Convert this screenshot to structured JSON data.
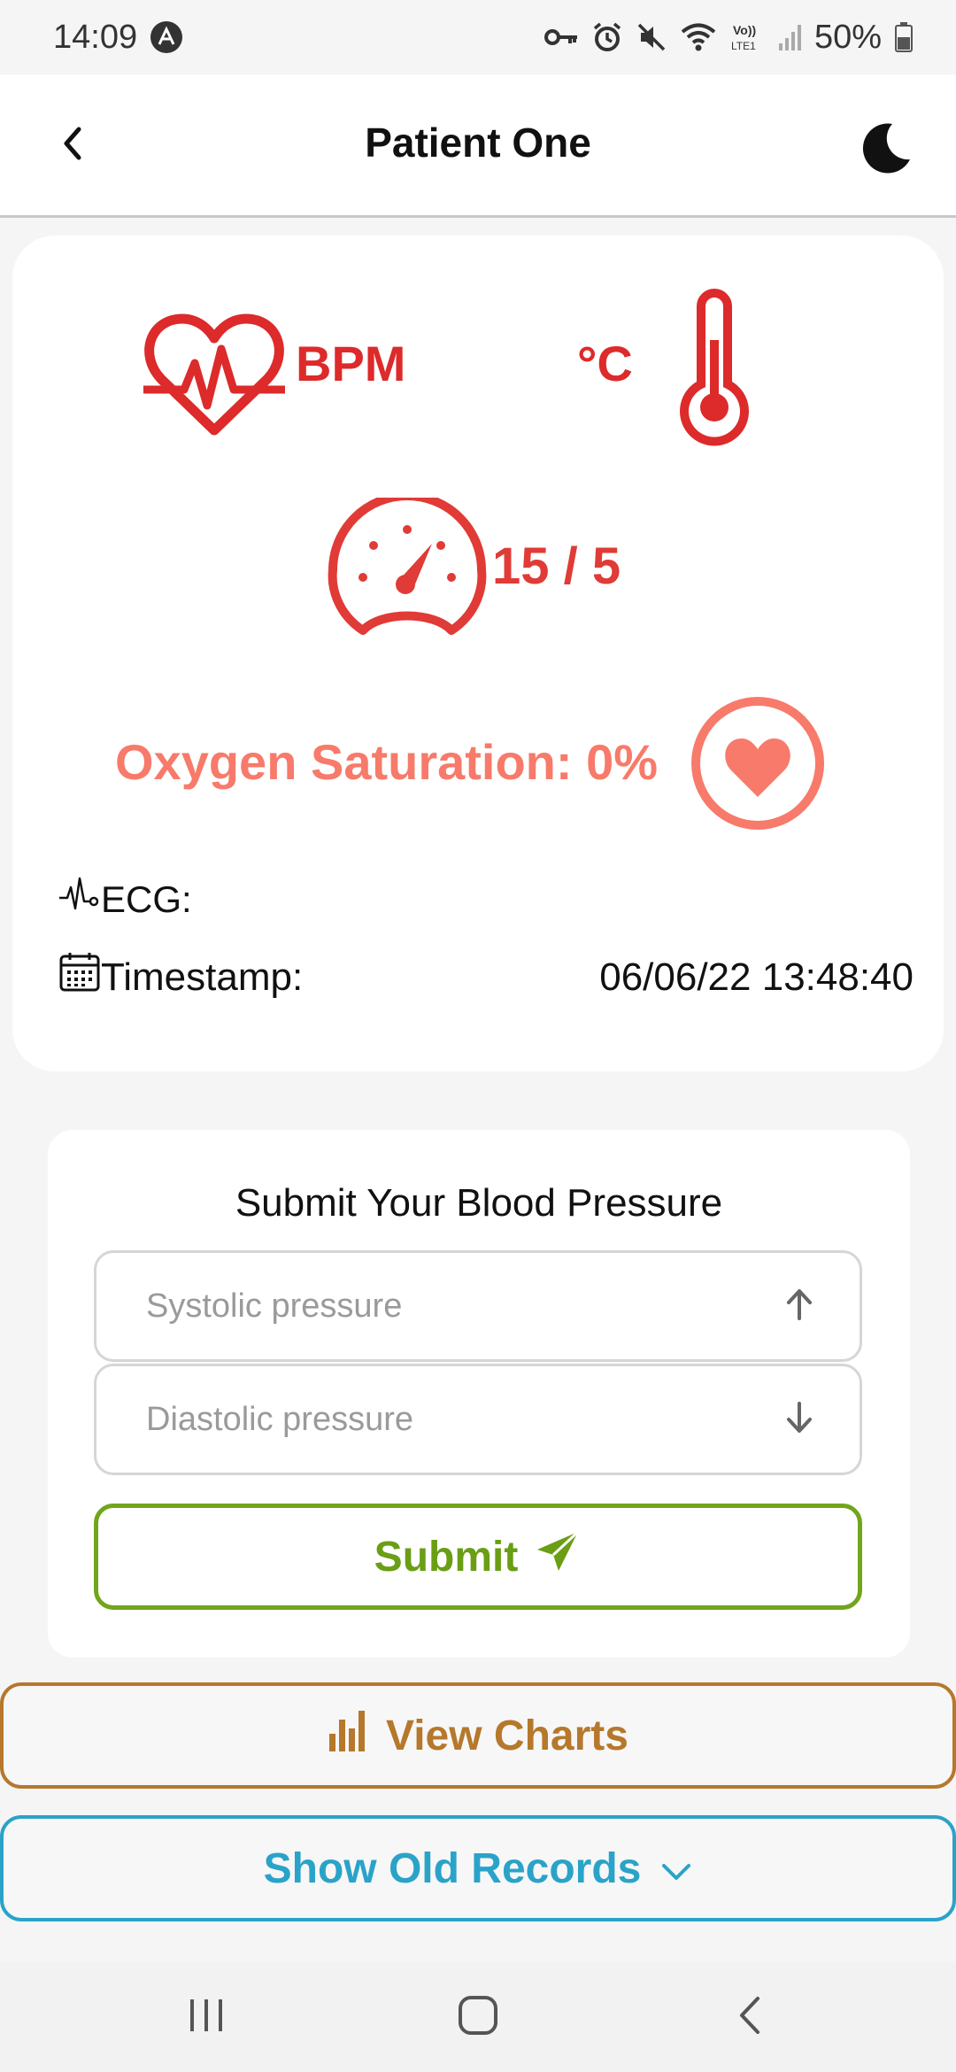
{
  "status_bar": {
    "time": "14:09",
    "battery": "50%",
    "icons": [
      "app-notification-icon",
      "key-icon",
      "alarm-icon",
      "mute-icon",
      "wifi-icon",
      "volte-icon",
      "signal-icon",
      "battery-icon"
    ],
    "volte_label": "Vo))\nLTE1"
  },
  "app_bar": {
    "title": "Patient One",
    "back_icon": "chevron-left-icon",
    "theme_icon": "moon-icon"
  },
  "vitals": {
    "bpm_label": "BPM",
    "temp_label": "°C",
    "blood_pressure": "15 / 5",
    "oxygen": "Oxygen Saturation: 0%",
    "ecg_label": "ECG:",
    "timestamp_label": "Timestamp:",
    "timestamp_value": "06/06/22 13:48:40",
    "colors": {
      "vital_red": "#dd2a2a",
      "oxygen": "#f77a6a"
    }
  },
  "bp_form": {
    "heading": "Submit Your Blood Pressure",
    "systolic_placeholder": "Systolic pressure",
    "diastolic_placeholder": "Diastolic pressure",
    "submit_label": "Submit",
    "submit_color": "#6a9e14"
  },
  "actions": {
    "charts_label": "View Charts",
    "charts_color": "#b5782c",
    "records_label": "Show Old Records",
    "records_color": "#2aa3c9"
  },
  "nav": {
    "recent_icon": "recent-apps-icon",
    "home_icon": "home-icon",
    "back_icon": "back-icon"
  }
}
